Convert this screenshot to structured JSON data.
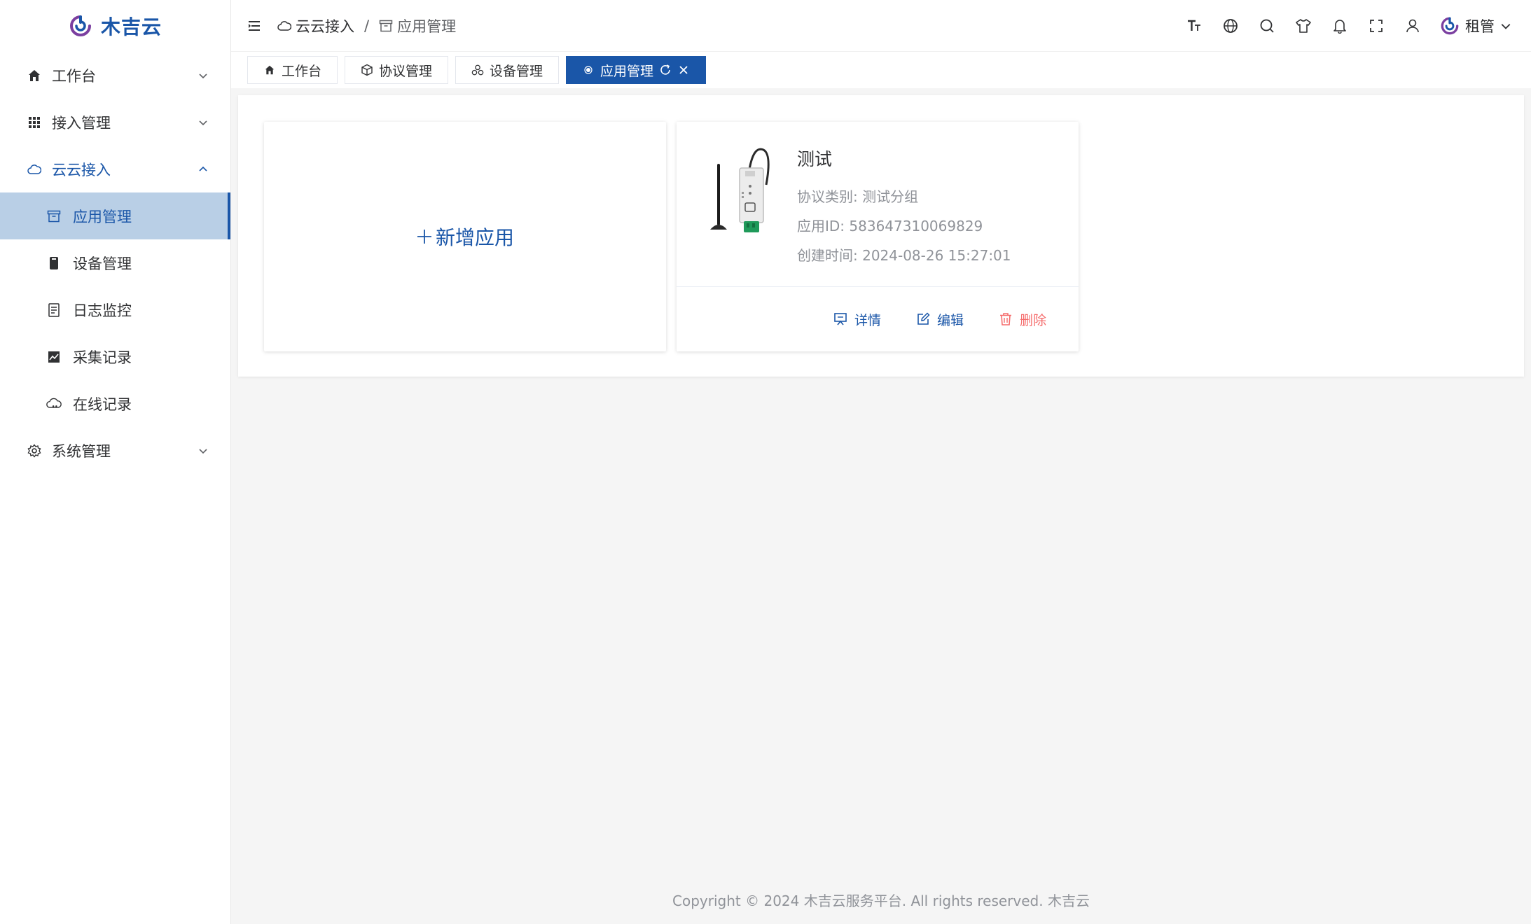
{
  "brand": {
    "name": "木吉云"
  },
  "sidebar": {
    "items": [
      {
        "label": "工作台",
        "icon": "home-icon"
      },
      {
        "label": "接入管理",
        "icon": "grid-icon"
      },
      {
        "label": "云云接入",
        "icon": "cloud-icon"
      },
      {
        "label": "系统管理",
        "icon": "gear-icon"
      }
    ],
    "sub_items": [
      {
        "label": "应用管理",
        "icon": "archive-box-icon"
      },
      {
        "label": "设备管理",
        "icon": "device-icon"
      },
      {
        "label": "日志监控",
        "icon": "document-icon"
      },
      {
        "label": "采集记录",
        "icon": "chart-icon"
      },
      {
        "label": "在线记录",
        "icon": "cloud-online-icon"
      }
    ]
  },
  "header": {
    "breadcrumb": [
      "云云接入",
      "应用管理"
    ],
    "separator": "/",
    "user_name": "租管"
  },
  "tabs": [
    {
      "label": "工作台",
      "icon": "home-icon"
    },
    {
      "label": "协议管理",
      "icon": "cube-icon"
    },
    {
      "label": "设备管理",
      "icon": "cluster-icon"
    },
    {
      "label": "应用管理",
      "icon": "dot-icon",
      "active": true
    }
  ],
  "main": {
    "add_card": {
      "label": "新增应用"
    },
    "app_card": {
      "name": "测试",
      "protocol": "协议类别: 测试分组",
      "app_id": "应用ID: 583647310069829",
      "created": "创建时间: 2024-08-26 15:27:01",
      "actions": {
        "detail": "详情",
        "edit": "编辑",
        "delete": "删除"
      }
    }
  },
  "footer": {
    "text": "Copyright © 2024 木吉云服务平台. All rights reserved. 木吉云"
  },
  "colors": {
    "primary": "#1a56a8",
    "active_bg": "#b9cfe6",
    "danger": "#f56c6c",
    "muted": "#909399"
  }
}
